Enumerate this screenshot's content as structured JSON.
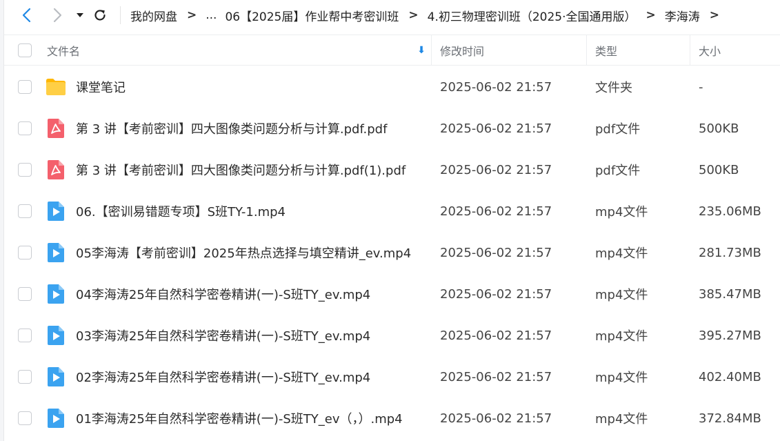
{
  "toolbar": {
    "breadcrumb": [
      {
        "label": "我的网盘"
      },
      {
        "label": "..."
      },
      {
        "label": "06【2025届】作业帮中考密训班"
      },
      {
        "label": "4.初三物理密训班（2025·全国通用版）"
      },
      {
        "label": "李海涛"
      }
    ],
    "separator": ">"
  },
  "table": {
    "headers": {
      "name": "文件名",
      "date": "修改时间",
      "type": "类型",
      "size": "大小"
    },
    "rows": [
      {
        "icon": "folder-icon",
        "name": "课堂笔记",
        "date": "2025-06-02 21:57",
        "type": "文件夹",
        "size": "-"
      },
      {
        "icon": "pdf-icon",
        "name": "第 3 讲【考前密训】四大图像类问题分析与计算.pdf.pdf",
        "date": "2025-06-02 21:57",
        "type": "pdf文件",
        "size": "500KB"
      },
      {
        "icon": "pdf-icon",
        "name": "第 3 讲【考前密训】四大图像类问题分析与计算.pdf(1).pdf",
        "date": "2025-06-02 21:57",
        "type": "pdf文件",
        "size": "500KB"
      },
      {
        "icon": "video-icon",
        "name": "06.【密训易错题专项】S班TY-1.mp4",
        "date": "2025-06-02 21:57",
        "type": "mp4文件",
        "size": "235.06MB"
      },
      {
        "icon": "video-icon",
        "name": "05李海涛【考前密训】2025年热点选择与填空精讲_ev.mp4",
        "date": "2025-06-02 21:57",
        "type": "mp4文件",
        "size": "281.73MB"
      },
      {
        "icon": "video-icon",
        "name": "04李海涛25年自然科学密卷精讲(一)-S班TY_ev.mp4",
        "date": "2025-06-02 21:57",
        "type": "mp4文件",
        "size": "385.47MB"
      },
      {
        "icon": "video-icon",
        "name": "03李海涛25年自然科学密卷精讲(一)-S班TY_ev.mp4",
        "date": "2025-06-02 21:57",
        "type": "mp4文件",
        "size": "395.27MB"
      },
      {
        "icon": "video-icon",
        "name": "02李海涛25年自然科学密卷精讲(一)-S班TY_ev.mp4",
        "date": "2025-06-02 21:57",
        "type": "mp4文件",
        "size": "402.40MB"
      },
      {
        "icon": "video-icon",
        "name": "01李海涛25年自然科学密卷精讲(一)-S班TY_ev（，）.mp4",
        "date": "2025-06-02 21:57",
        "type": "mp4文件",
        "size": "372.84MB"
      }
    ]
  },
  "colors": {
    "accent": "#1e88e5",
    "folder": "#ffc93c",
    "pdf": "#f4606c",
    "video": "#3ba3f0"
  }
}
